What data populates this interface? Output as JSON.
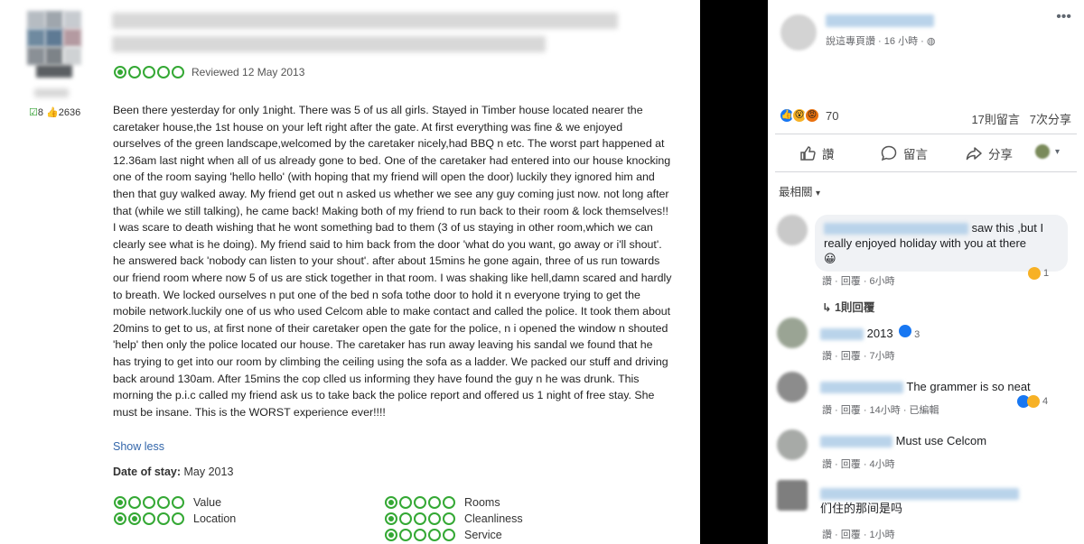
{
  "review": {
    "reviewed_date": "Reviewed 12 May 2013",
    "rating_bubbles": 1,
    "stats": {
      "reviews_icon_count": "8",
      "helpful_count": "2636"
    },
    "body": "Been there yesterday for only 1night. There was 5 of us all girls. Stayed in Timber house located nearer the caretaker house,the 1st house on your left right after the gate. At first everything was fine & we enjoyed ourselves of the green landscape,welcomed by the caretaker nicely,had BBQ n etc. The worst part happened at 12.36am last night when all of us already gone to bed. One of the caretaker had entered into our house knocking one of the room saying 'hello hello' (with hoping that my friend will open the door) luckily they ignored him and then that guy walked away. My friend get out n asked us whether we see any guy coming just now. not long after that (while we still talking), he came back! Making both of my friend to run back to their room & lock themselves!! I was scare to death wishing that he wont something bad to them (3 of us staying in other room,which we can clearly see what is he doing). My friend said to him back from the door 'what do you want, go away or i'll shout'. he answered back 'nobody can listen to your shout'. after about 15mins he gone again, three of us run towards our friend room where now 5 of us are stick together in that room. I was shaking like hell,damn scared and hardly to breath. We locked ourselves n put one of the bed n sofa tothe door to hold it n everyone trying to get the mobile network.luckily one of us who used Celcom able to make contact and called the police. It took them about 20mins to get to us, at first none of their caretaker open the gate for the police, n i opened the window n shouted 'help' then only the police located our house. The caretaker has run away leaving his sandal we found that he has trying to get into our room by climbing the ceiling using the sofa as a ladder. We packed our stuff and driving back around 130am. After 15mins the cop clled us informing they have found the guy n he was drunk. This morning the p.i.c called my friend ask us to take back the police report and offered us 1 night of free stay. She must be insane. This is the WORST experience ever!!!!",
    "show_less": "Show less",
    "date_of_stay_label": "Date of stay:",
    "date_of_stay_value": "May 2013",
    "sub_ratings": [
      {
        "label": "Value",
        "bubbles": 1
      },
      {
        "label": "Location",
        "bubbles": 2
      },
      {
        "label": "Rooms",
        "bubbles": 1
      },
      {
        "label": "Cleanliness",
        "bubbles": 1
      },
      {
        "label": "Service",
        "bubbles": 1
      }
    ]
  },
  "facebook": {
    "post_sub": "說這專頁讚 · 16 小時 · ",
    "reaction_count": "70",
    "comment_count": "17則留言",
    "share_count": "7次分享",
    "actions": {
      "like": "讚",
      "comment": "留言",
      "share": "分享"
    },
    "sort_label": "最相關",
    "comments": [
      {
        "text": "saw this ,but I really enjoyed holiday with you at there",
        "emoji": "😀",
        "meta": "讚 · 回覆 · 6小時",
        "react_count": "1"
      },
      {
        "text": "2013",
        "meta": "讚 · 回覆 · 7小時",
        "react_count": "3"
      },
      {
        "text": "The grammer is so neat",
        "meta": "讚 · 回覆 · 14小時 · 已編輯",
        "react_count": "4"
      },
      {
        "text": "Must use Celcom",
        "meta": "讚 · 回覆 · 4小時"
      },
      {
        "text": "们住的那间是吗",
        "meta": "讚 · 回覆 · 1小時"
      }
    ],
    "reply_link": "1則回覆"
  },
  "colors": {
    "bubble_green": "#34a834",
    "fb_blue": "#1877f2",
    "divider": "#000000"
  }
}
